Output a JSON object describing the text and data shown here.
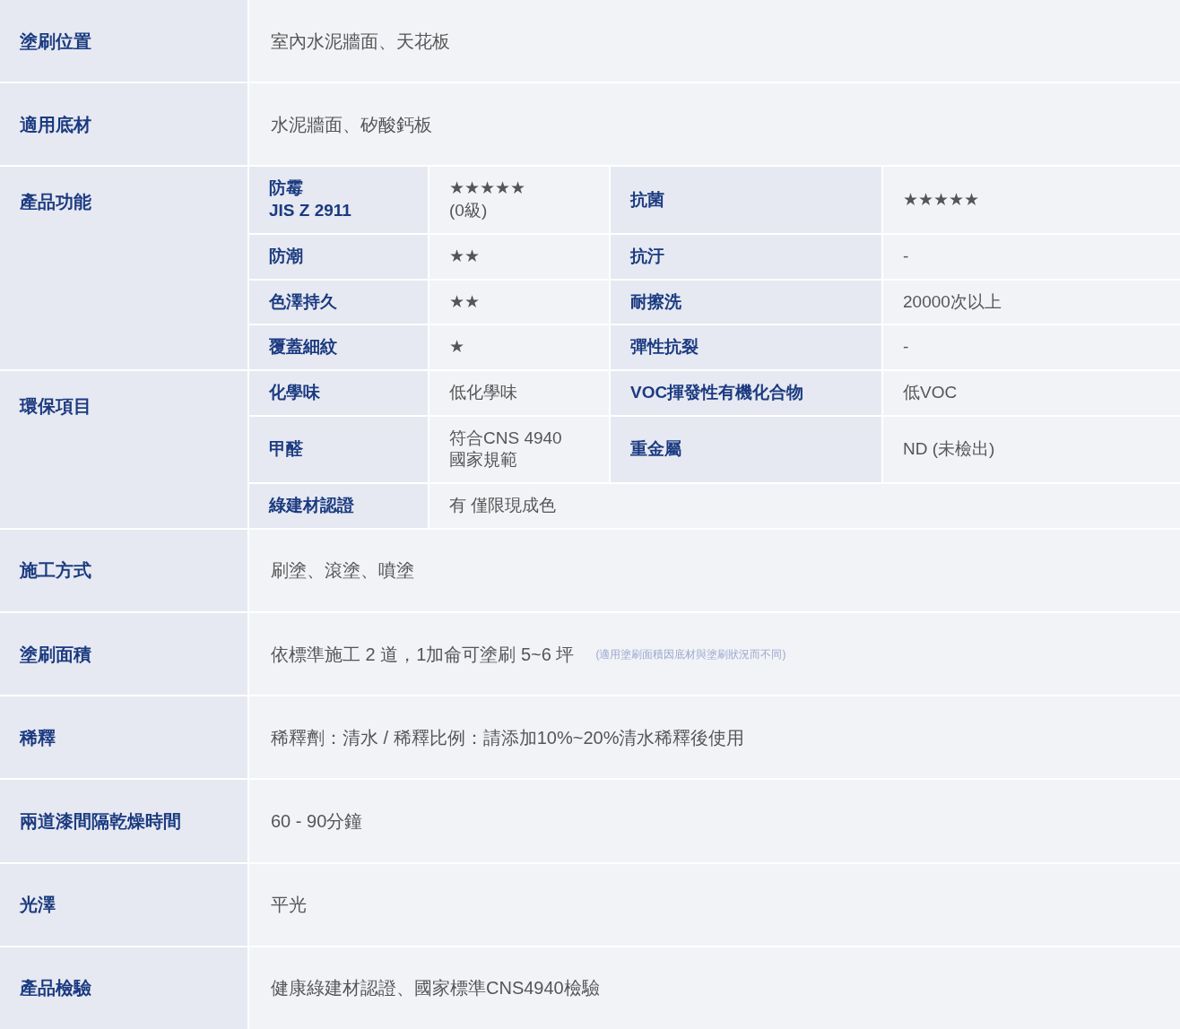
{
  "rows": [
    {
      "label": "塗刷位置",
      "value": "室內水泥牆面、天花板"
    },
    {
      "label": "適用底材",
      "value": "水泥牆面、矽酸鈣板"
    },
    {
      "label": "產品功能",
      "grid": [
        [
          {
            "kind": "label",
            "text": "防霉\nJIS Z 2911"
          },
          {
            "kind": "text",
            "text": "★★★★★\n(0級)"
          },
          {
            "kind": "label",
            "text": "抗菌"
          },
          {
            "kind": "text",
            "text": "★★★★★"
          }
        ],
        [
          {
            "kind": "label",
            "text": "防潮"
          },
          {
            "kind": "text",
            "text": "★★"
          },
          {
            "kind": "label",
            "text": "抗汙"
          },
          {
            "kind": "text",
            "text": "-"
          }
        ],
        [
          {
            "kind": "label",
            "text": "色澤持久"
          },
          {
            "kind": "text",
            "text": "★★"
          },
          {
            "kind": "label",
            "text": "耐擦洗"
          },
          {
            "kind": "text",
            "text": "20000次以上"
          }
        ],
        [
          {
            "kind": "label",
            "text": "覆蓋細紋"
          },
          {
            "kind": "text",
            "text": "★"
          },
          {
            "kind": "label",
            "text": "彈性抗裂"
          },
          {
            "kind": "text",
            "text": "-"
          }
        ]
      ]
    },
    {
      "label": "環保項目",
      "grid": [
        [
          {
            "kind": "label",
            "text": "化學味"
          },
          {
            "kind": "text",
            "text": "低化學味"
          },
          {
            "kind": "label",
            "text": "VOC揮發性有機化合物"
          },
          {
            "kind": "text",
            "text": "低VOC"
          }
        ],
        [
          {
            "kind": "label",
            "text": "甲醛"
          },
          {
            "kind": "text",
            "text": "符合CNS 4940\n國家規範"
          },
          {
            "kind": "label",
            "text": "重金屬"
          },
          {
            "kind": "text",
            "text": "ND (未檢出)"
          }
        ],
        [
          {
            "kind": "label",
            "text": "綠建材認證"
          },
          {
            "kind": "text",
            "text": "有 僅限現成色"
          }
        ]
      ]
    },
    {
      "label": "施工方式",
      "value": "刷塗、滾塗、噴塗"
    },
    {
      "label": "塗刷面積",
      "value": "依標準施工 2 道，1加侖可塗刷 5~6 坪",
      "note": "(適用塗刷面積因底材與塗刷狀況而不同)"
    },
    {
      "label": "稀釋",
      "value": "稀釋劑：清水 / 稀釋比例：請添加10%~20%清水稀釋後使用"
    },
    {
      "label": "兩道漆間隔乾燥時間",
      "value": "60 - 90分鐘"
    },
    {
      "label": "光澤",
      "value": "平光"
    },
    {
      "label": "產品檢驗",
      "value": "健康綠建材認證、國家標準CNS4940檢驗"
    }
  ]
}
